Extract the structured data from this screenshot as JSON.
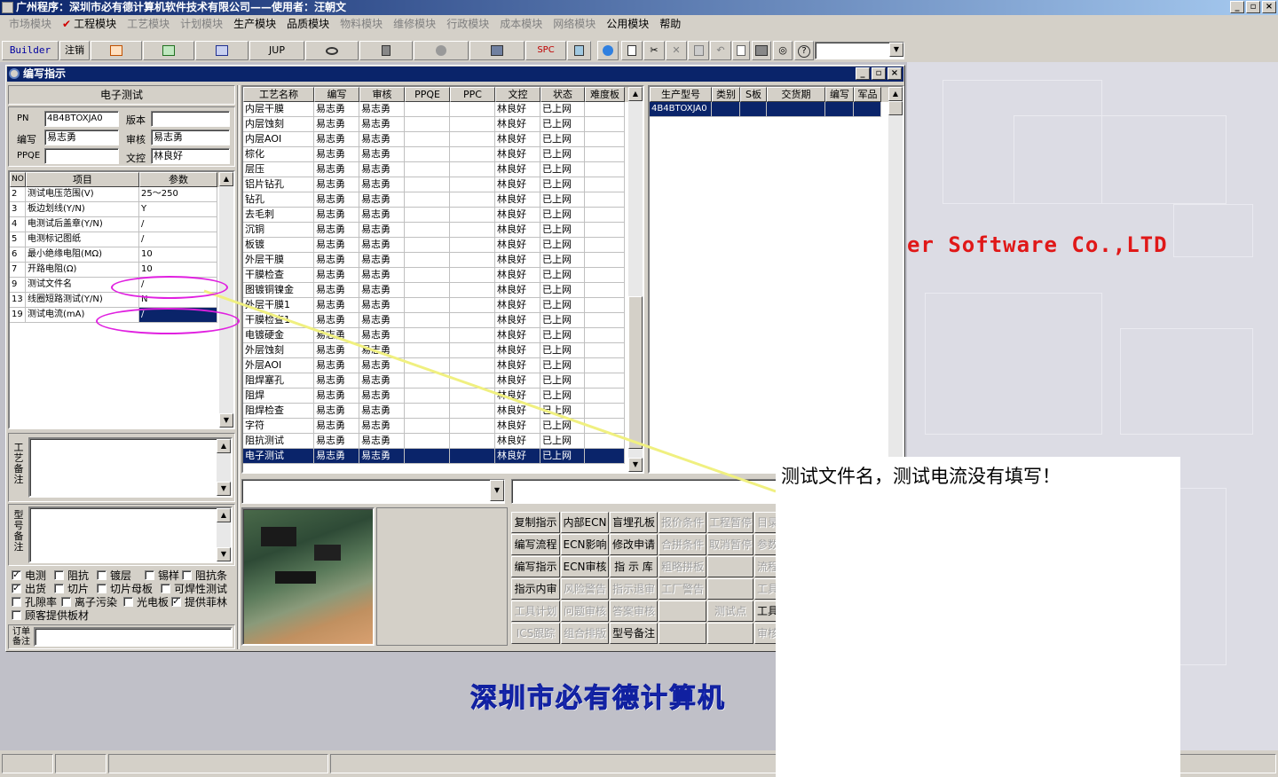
{
  "app": {
    "title": "广州程序：深圳市必有德计算机软件技术有限公司——使用者：汪朝文",
    "caption_buttons": [
      "_",
      "▫",
      "×"
    ]
  },
  "menubar": [
    {
      "label": "市场模块",
      "enabled": false
    },
    {
      "label": "工程模块",
      "enabled": true,
      "checked": true
    },
    {
      "label": "工艺模块",
      "enabled": false
    },
    {
      "label": "计划模块",
      "enabled": false
    },
    {
      "label": "生产模块",
      "enabled": true
    },
    {
      "label": "品质模块",
      "enabled": true
    },
    {
      "label": "物料模块",
      "enabled": false
    },
    {
      "label": "维修模块",
      "enabled": false
    },
    {
      "label": "行政模块",
      "enabled": false
    },
    {
      "label": "成本模块",
      "enabled": false
    },
    {
      "label": "网络模块",
      "enabled": false
    },
    {
      "label": "公用模块",
      "enabled": true
    },
    {
      "label": "帮助",
      "enabled": true
    }
  ],
  "toolbar": {
    "builder": "Builder",
    "logout": "注销",
    "jup": "JUP",
    "spc": "SPC"
  },
  "window": {
    "title": "编写指示",
    "heading": "电子测试",
    "labels": {
      "pn": "PN",
      "version": "版本",
      "writer": "编写",
      "reviewer": "审核",
      "ppqe": "PPQE",
      "doc_control": "文控"
    },
    "values": {
      "pn": "4B4BTOXJA0",
      "version": "",
      "writer": "易志勇",
      "reviewer": "易志勇",
      "ppqe": "",
      "doc_control": "林良好"
    }
  },
  "params": {
    "headers": [
      "NO",
      "项目",
      "参数"
    ],
    "rows": [
      [
        "2",
        "测试电压范围(V)",
        "25～250"
      ],
      [
        "3",
        "板边划线(Y/N)",
        "Y"
      ],
      [
        "4",
        "电测试后盖章(Y/N)",
        "/"
      ],
      [
        "5",
        "电测标记图纸",
        "/"
      ],
      [
        "6",
        "最小绝缘电阻(MΩ)",
        "10"
      ],
      [
        "7",
        "开路电阻(Ω)",
        "10"
      ],
      [
        "9",
        "测试文件名",
        "/"
      ],
      [
        "13",
        "线圈短路测试(Y/N)",
        "N"
      ],
      [
        "19",
        "测试电流(mA)",
        "/"
      ]
    ],
    "selected_row": 8
  },
  "memo_labels": {
    "process_note": "工艺备注",
    "model_note": "型号备注",
    "order_note": "订单备注"
  },
  "checkboxes": [
    {
      "label": "电测",
      "checked": true
    },
    {
      "label": "阻抗",
      "checked": false
    },
    {
      "label": "镀层",
      "checked": false
    },
    {
      "label": "锡样",
      "checked": false
    },
    {
      "label": "阻抗条",
      "checked": false
    },
    {
      "label": "出货",
      "checked": true
    },
    {
      "label": "切片",
      "checked": false
    },
    {
      "label": "切片母板",
      "checked": false
    },
    {
      "label": "可焊性测试",
      "checked": false
    },
    {
      "label": "孔隙率",
      "checked": false
    },
    {
      "label": "离子污染",
      "checked": false
    },
    {
      "label": "光电板",
      "checked": false
    },
    {
      "label": "提供菲林",
      "checked": true
    },
    {
      "label": "顾客提供板材",
      "checked": false
    }
  ],
  "process_grid": {
    "headers": [
      "工艺名称",
      "编写",
      "审核",
      "PPQE",
      "PPC",
      "文控",
      "状态",
      "难度板"
    ],
    "rows": [
      [
        "内层干膜",
        "易志勇",
        "易志勇",
        "",
        "",
        "林良好",
        "已上网",
        ""
      ],
      [
        "内层蚀刻",
        "易志勇",
        "易志勇",
        "",
        "",
        "林良好",
        "已上网",
        ""
      ],
      [
        "内层AOI",
        "易志勇",
        "易志勇",
        "",
        "",
        "林良好",
        "已上网",
        ""
      ],
      [
        "棕化",
        "易志勇",
        "易志勇",
        "",
        "",
        "林良好",
        "已上网",
        ""
      ],
      [
        "层压",
        "易志勇",
        "易志勇",
        "",
        "",
        "林良好",
        "已上网",
        ""
      ],
      [
        "铝片钻孔",
        "易志勇",
        "易志勇",
        "",
        "",
        "林良好",
        "已上网",
        ""
      ],
      [
        "钻孔",
        "易志勇",
        "易志勇",
        "",
        "",
        "林良好",
        "已上网",
        ""
      ],
      [
        "去毛刺",
        "易志勇",
        "易志勇",
        "",
        "",
        "林良好",
        "已上网",
        ""
      ],
      [
        "沉铜",
        "易志勇",
        "易志勇",
        "",
        "",
        "林良好",
        "已上网",
        ""
      ],
      [
        "板镀",
        "易志勇",
        "易志勇",
        "",
        "",
        "林良好",
        "已上网",
        ""
      ],
      [
        "外层干膜",
        "易志勇",
        "易志勇",
        "",
        "",
        "林良好",
        "已上网",
        ""
      ],
      [
        "干膜检查",
        "易志勇",
        "易志勇",
        "",
        "",
        "林良好",
        "已上网",
        ""
      ],
      [
        "图镀铜镍金",
        "易志勇",
        "易志勇",
        "",
        "",
        "林良好",
        "已上网",
        ""
      ],
      [
        "外层干膜1",
        "易志勇",
        "易志勇",
        "",
        "",
        "林良好",
        "已上网",
        ""
      ],
      [
        "干膜检查1",
        "易志勇",
        "易志勇",
        "",
        "",
        "林良好",
        "已上网",
        ""
      ],
      [
        "电镀硬金",
        "易志勇",
        "易志勇",
        "",
        "",
        "林良好",
        "已上网",
        ""
      ],
      [
        "外层蚀刻",
        "易志勇",
        "易志勇",
        "",
        "",
        "林良好",
        "已上网",
        ""
      ],
      [
        "外层AOI",
        "易志勇",
        "易志勇",
        "",
        "",
        "林良好",
        "已上网",
        ""
      ],
      [
        "阻焊塞孔",
        "易志勇",
        "易志勇",
        "",
        "",
        "林良好",
        "已上网",
        ""
      ],
      [
        "阻焊",
        "易志勇",
        "易志勇",
        "",
        "",
        "林良好",
        "已上网",
        ""
      ],
      [
        "阻焊检查",
        "易志勇",
        "易志勇",
        "",
        "",
        "林良好",
        "已上网",
        ""
      ],
      [
        "字符",
        "易志勇",
        "易志勇",
        "",
        "",
        "林良好",
        "已上网",
        ""
      ],
      [
        "阻抗测试",
        "易志勇",
        "易志勇",
        "",
        "",
        "林良好",
        "已上网",
        ""
      ],
      [
        "电子测试",
        "易志勇",
        "易志勇",
        "",
        "",
        "林良好",
        "已上网",
        ""
      ]
    ],
    "selected_row": 23
  },
  "model_grid": {
    "headers": [
      "生产型号",
      "类别",
      "S板",
      "交货期",
      "编写",
      "军品"
    ],
    "rows": [
      [
        "4B4BTOXJA0",
        "",
        "",
        "",
        "",
        ""
      ]
    ]
  },
  "action_buttons": [
    [
      {
        "label": "复制指示",
        "enabled": true
      },
      {
        "label": "内部ECN",
        "enabled": true
      },
      {
        "label": "盲埋孔板",
        "enabled": true
      },
      {
        "label": "报价条件",
        "enabled": false
      },
      {
        "label": "工程暂停",
        "enabled": false
      },
      {
        "label": "目录",
        "enabled": false
      }
    ],
    [
      {
        "label": "编写流程",
        "enabled": true
      },
      {
        "label": "ECN影响",
        "enabled": true
      },
      {
        "label": "修改申请",
        "enabled": true
      },
      {
        "label": "合拼条件",
        "enabled": false
      },
      {
        "label": "取消暂停",
        "enabled": false
      },
      {
        "label": "参数",
        "enabled": false
      }
    ],
    [
      {
        "label": "编写指示",
        "enabled": true
      },
      {
        "label": "ECN审核",
        "enabled": true
      },
      {
        "label": "指 示 库",
        "enabled": true
      },
      {
        "label": "粗略拼板",
        "enabled": false
      },
      {
        "label": "",
        "enabled": false
      },
      {
        "label": "流程",
        "enabled": false
      }
    ],
    [
      {
        "label": "指示内审",
        "enabled": true
      },
      {
        "label": "风险警告",
        "enabled": false
      },
      {
        "label": "指示退审",
        "enabled": false
      },
      {
        "label": "工厂警告",
        "enabled": false
      },
      {
        "label": "",
        "enabled": false
      },
      {
        "label": "工具",
        "enabled": false
      }
    ],
    [
      {
        "label": "工具计划",
        "enabled": false
      },
      {
        "label": "问题审核",
        "enabled": false
      },
      {
        "label": "答案审核",
        "enabled": false
      },
      {
        "label": "",
        "enabled": false
      },
      {
        "label": "测试点",
        "enabled": false
      },
      {
        "label": "工具",
        "enabled": true
      }
    ],
    [
      {
        "label": "ICS跟踪",
        "enabled": false
      },
      {
        "label": "组合排版",
        "enabled": false
      },
      {
        "label": "型号备注",
        "enabled": true
      },
      {
        "label": "",
        "enabled": false
      },
      {
        "label": "",
        "enabled": false
      },
      {
        "label": "审核",
        "enabled": false
      }
    ]
  ],
  "background": {
    "company_en": "er Software Co.,LTD",
    "company_cn": "深圳市必有德计算机"
  },
  "annotation": {
    "text": "测试文件名，测试电流没有填写！"
  },
  "colors": {
    "selection": "#0a246a",
    "annotation_ellipse": "#e020e0",
    "annotation_line": "#f0f080",
    "brand_red": "#e01818",
    "brand_blue": "#3040d0"
  }
}
